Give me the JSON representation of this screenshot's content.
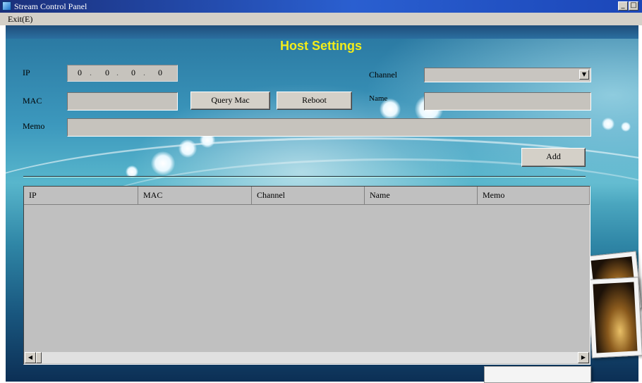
{
  "window": {
    "title": "Stream Control Panel",
    "minimize": "_",
    "maximize": "□"
  },
  "menu": {
    "exit": "Exit(E)"
  },
  "heading": "Host Settings",
  "form": {
    "ip_label": "IP",
    "ip_octets": [
      "0",
      "0",
      "0",
      "0"
    ],
    "ip_dot": ".",
    "mac_label": "MAC",
    "mac_value": "",
    "memo_label": "Memo",
    "memo_value": "",
    "channel_label": "Channel",
    "channel_value": "",
    "name_label": "Name",
    "name_value": ""
  },
  "buttons": {
    "query_mac": "Query Mac",
    "reboot": "Reboot",
    "add": "Add"
  },
  "table": {
    "columns": [
      "IP",
      "MAC",
      "Channel",
      "Name",
      "Memo"
    ],
    "rows": []
  },
  "scrollbar": {
    "left": "◀",
    "right": "▶"
  },
  "colors": {
    "heading": "#f2ec1a",
    "panel_gray": "#c0c0c0",
    "title_bar": "#2a5fd0"
  }
}
